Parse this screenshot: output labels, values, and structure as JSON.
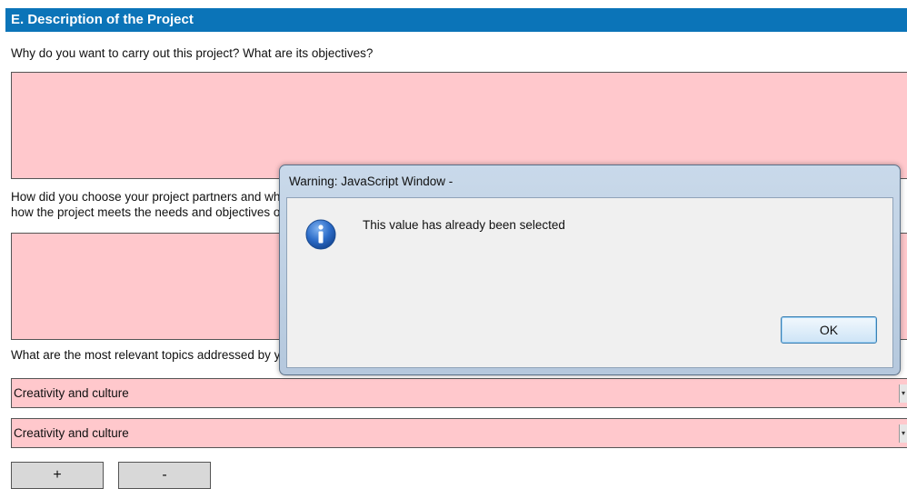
{
  "section": {
    "title": "E. Description of the Project"
  },
  "questions": [
    "Why do you want to carry out this project? What are its objectives?",
    "How did you choose your project partners and what will they bring to the project? Please also describe",
    "how the project meets the needs and objectives of the participating organisations.",
    "What are the most relevant topics addressed by your project?"
  ],
  "textboxes": [
    {
      "value": ""
    },
    {
      "value": ""
    }
  ],
  "topics": [
    {
      "value": "Creativity and culture"
    },
    {
      "value": "Creativity and culture"
    }
  ],
  "buttons": {
    "add": "+",
    "remove": "-"
  },
  "dialog": {
    "title": "Warning: JavaScript Window -",
    "message": "This value has already been selected",
    "ok_label": "OK",
    "icon": "info-icon",
    "accent": "#1f5fb4"
  },
  "colors": {
    "header": "#0b74b8",
    "field": "#ffc8cc"
  }
}
